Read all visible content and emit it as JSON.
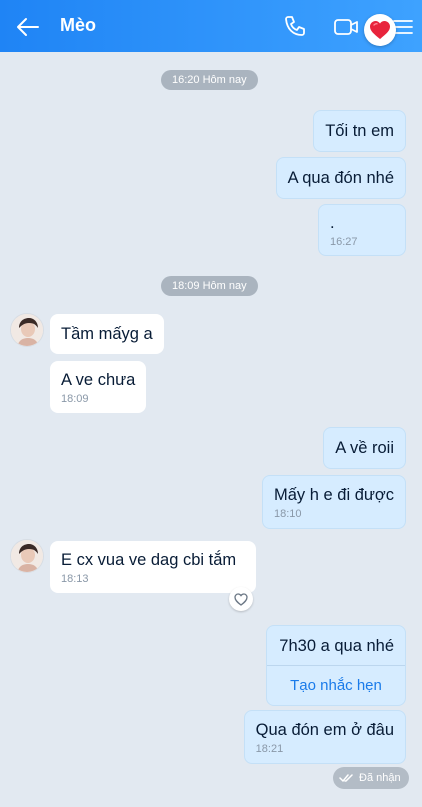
{
  "header": {
    "title": "Mèo",
    "back_icon": "arrow-left-icon",
    "call_icon": "phone-icon",
    "video_icon": "video-camera-icon",
    "menu_icon": "menu-icon",
    "badge_icon": "heart-icon",
    "color": "#2b93fa"
  },
  "separators": [
    "16:20 Hôm nay",
    "18:09 Hôm nay"
  ],
  "messages": [
    {
      "text": "Tối tn em",
      "time": ""
    },
    {
      "text": "A qua đón nhé",
      "time": ""
    },
    {
      "text": ".",
      "time": "16:27"
    },
    {
      "text": "Tầm mấyg a",
      "time": ""
    },
    {
      "text": "A ve chưa",
      "time": "18:09"
    },
    {
      "text": "A về roii",
      "time": ""
    },
    {
      "text": "Mấy h e đi được",
      "time": "18:10"
    },
    {
      "text": "E cx  vua ve dag cbi tắm",
      "time": "18:13"
    },
    {
      "text": "7h30 a qua nhé",
      "action": "Tạo nhắc hẹn"
    },
    {
      "text": "Qua đón em ở đâu",
      "time": "18:21"
    }
  ],
  "status": {
    "label": "Đã nhận",
    "icon": "double-check-icon"
  },
  "colors": {
    "my_bubble": "#d6ecff",
    "their_bubble": "#ffffff",
    "background": "#e2e9f1",
    "link": "#1a7bea"
  }
}
